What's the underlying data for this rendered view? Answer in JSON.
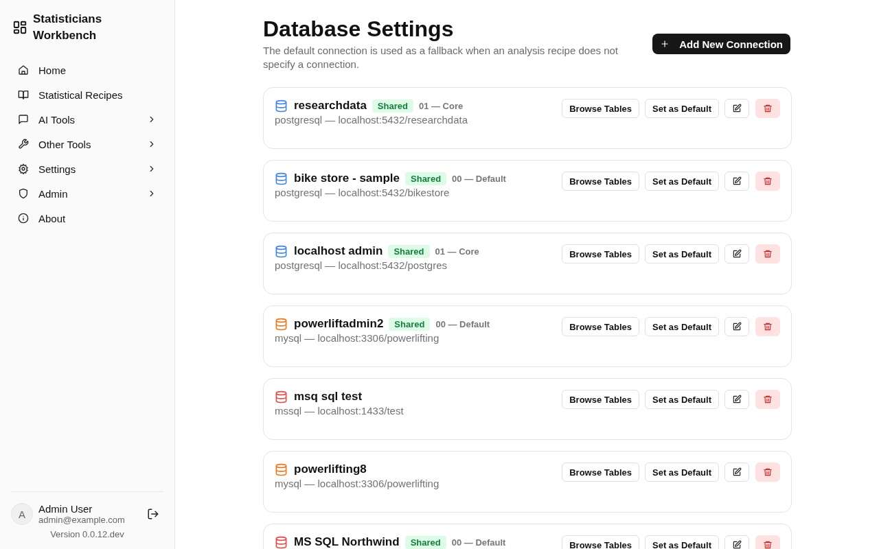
{
  "app": {
    "title": "Statisticians Workbench"
  },
  "sidebar": {
    "items": [
      {
        "label": "Home",
        "expandable": false
      },
      {
        "label": "Statistical Recipes",
        "expandable": false
      },
      {
        "label": "AI Tools",
        "expandable": true
      },
      {
        "label": "Other Tools",
        "expandable": true
      },
      {
        "label": "Settings",
        "expandable": true
      },
      {
        "label": "Admin",
        "expandable": true
      },
      {
        "label": "About",
        "expandable": false
      }
    ]
  },
  "user": {
    "initial": "A",
    "name": "Admin User",
    "email": "admin@example.com",
    "version": "Version 0.0.12.dev"
  },
  "page": {
    "title": "Database Settings",
    "description": "The default connection is used as a fallback when an analysis recipe does not specify a connection.",
    "add_button": "Add New Connection"
  },
  "connections": [
    {
      "name": "researchdata",
      "badge": "Shared",
      "meta": "01 — Core",
      "url": "postgresql — localhost:5432/researchdata",
      "color": "#3b82f6",
      "browse": "Browse Tables",
      "set_default": "Set as Default"
    },
    {
      "name": "bike store - sample",
      "badge": "Shared",
      "meta": "00 — Default",
      "url": "postgresql — localhost:5432/bikestore",
      "color": "#3b82f6",
      "browse": "Browse Tables",
      "set_default": "Set as Default"
    },
    {
      "name": "localhost admin",
      "badge": "Shared",
      "meta": "01 — Core",
      "url": "postgresql — localhost:5432/postgres",
      "color": "#3b82f6",
      "browse": "Browse Tables",
      "set_default": "Set as Default"
    },
    {
      "name": "powerliftadmin2",
      "badge": "Shared",
      "meta": "00 — Default",
      "url": "mysql — localhost:3306/powerlifting",
      "color": "#f97316",
      "browse": "Browse Tables",
      "set_default": "Set as Default"
    },
    {
      "name": "msq sql test",
      "url": "mssql — localhost:1433/test",
      "color": "#ef4444",
      "browse": "Browse Tables",
      "set_default": "Set as Default"
    },
    {
      "name": "powerlifting8",
      "url": "mysql — localhost:3306/powerlifting",
      "color": "#f97316",
      "browse": "Browse Tables",
      "set_default": "Set as Default"
    },
    {
      "name": "MS SQL Northwind",
      "badge": "Shared",
      "meta": "00 — Default",
      "color": "#ef4444",
      "browse": "Browse Tables",
      "set_default": "Set as Default"
    }
  ]
}
